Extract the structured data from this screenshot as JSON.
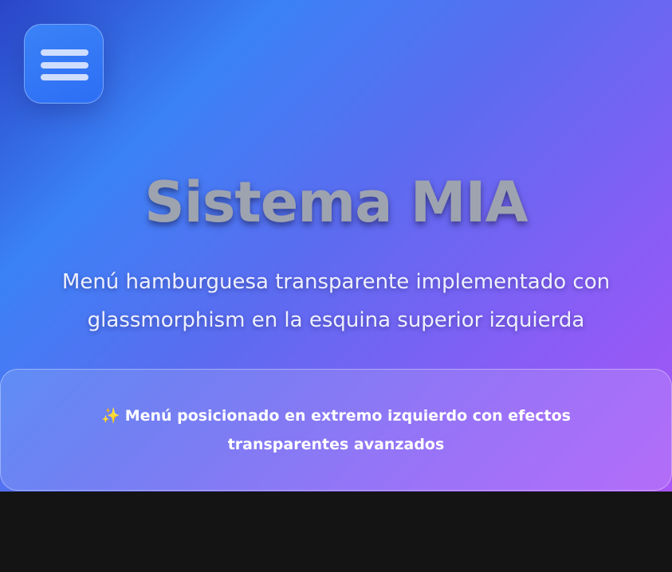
{
  "menu": {
    "icon": "hamburger-icon"
  },
  "hero": {
    "title": "Sistema MIA",
    "subtitle": "Menú hamburguesa transparente implementado con glassmorphism en la esquina superior izquierda"
  },
  "card": {
    "icon": "sparkles-icon",
    "icon_glyph": "✨",
    "text": "Menú posicionado en extremo izquierdo con efectos transparentes avanzados"
  },
  "colors": {
    "gradient_start": "#2a45c8",
    "gradient_mid": "#3b82f6",
    "gradient_end": "#a855f7",
    "footer_background": "#141414"
  }
}
